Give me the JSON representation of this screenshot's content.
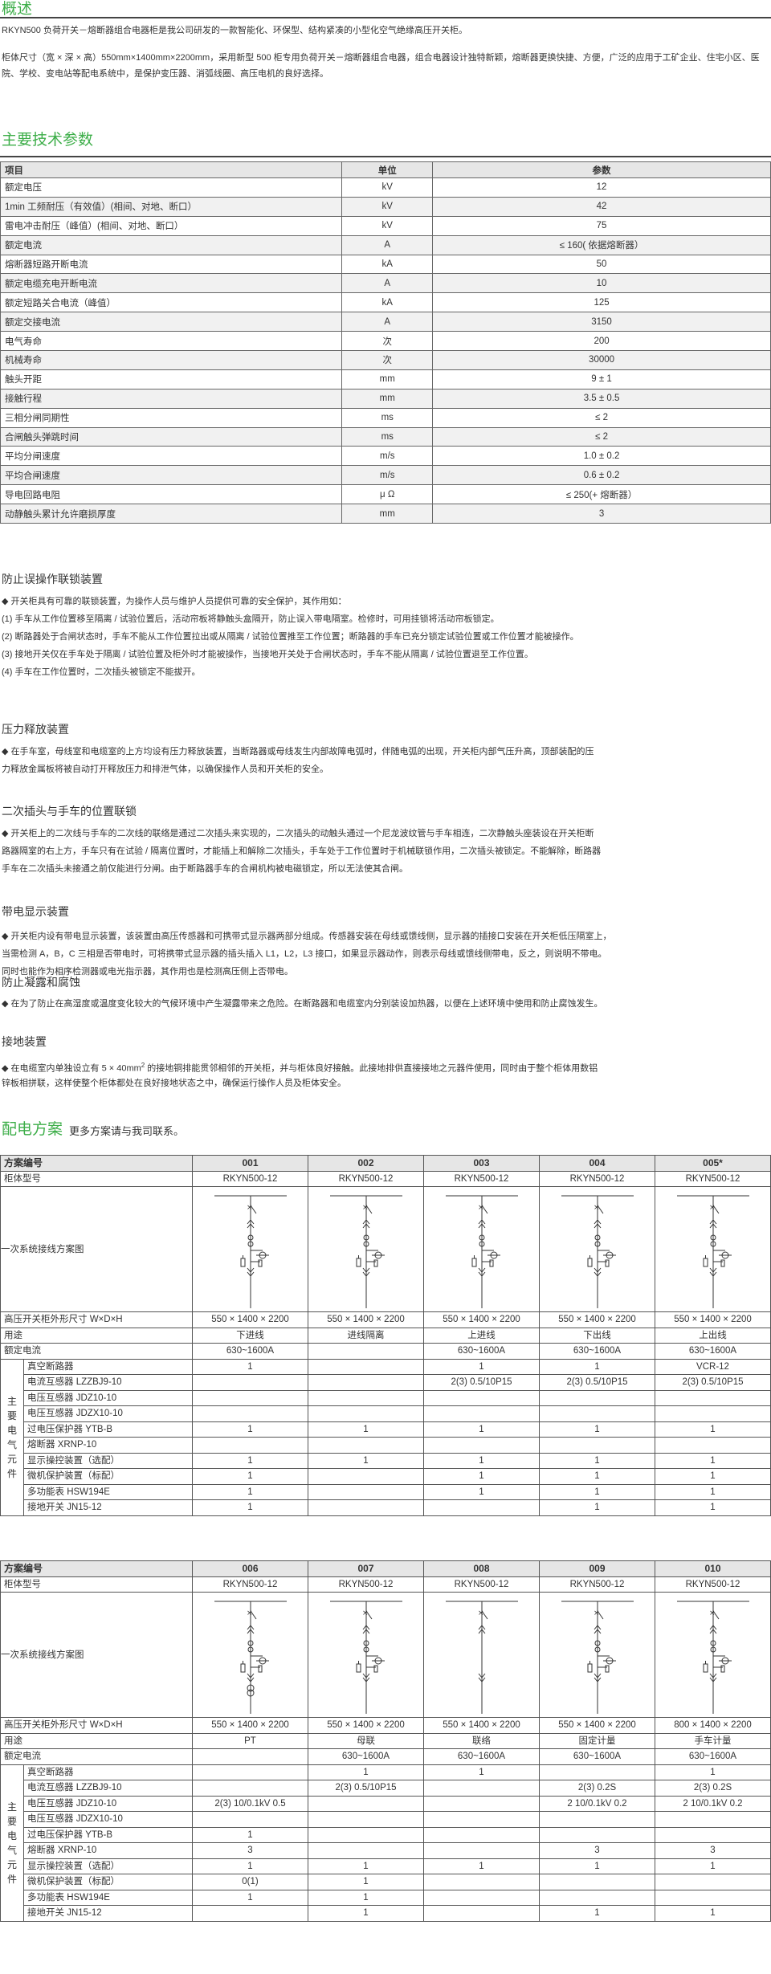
{
  "overview": {
    "title": "概述",
    "p1": "RKYN500 负荷开关－熔断器组合电器柜是我公司研发的一款智能化、环保型、结构紧凑的小型化空气绝缘高压开关柜。",
    "p2": "柜体尺寸（宽 × 深 × 高）550mm×1400mm×2200mm，采用新型 500 柜专用负荷开关－熔断器组合电器，组合电器设计独特新颖，熔断器更换快捷、方便，广泛的应用于工矿企业、住宅小区、医院、学校、变电站等配电系统中，是保护变压器、消弧线圈、高压电机的良好选择。"
  },
  "params": {
    "title": "主要技术参数",
    "headers": [
      "项目",
      "单位",
      "参数"
    ],
    "rows": [
      [
        "额定电压",
        "kV",
        "12"
      ],
      [
        "1min 工频耐压（有效值）(相间、对地、断口）",
        "kV",
        "42"
      ],
      [
        "雷电冲击耐压（峰值）(相间、对地、断口）",
        "kV",
        "75"
      ],
      [
        "额定电流",
        "A",
        "≤ 160( 依据熔断器）"
      ],
      [
        "熔断器短路开断电流",
        "kA",
        "50"
      ],
      [
        "额定电缆充电开断电流",
        "A",
        "10"
      ],
      [
        "额定短路关合电流（峰值）",
        "kA",
        "125"
      ],
      [
        "额定交接电流",
        "A",
        "3150"
      ],
      [
        "电气寿命",
        "次",
        "200"
      ],
      [
        "机械寿命",
        "次",
        "30000"
      ],
      [
        "触头开距",
        "mm",
        "9 ± 1"
      ],
      [
        "接触行程",
        "mm",
        "3.5 ± 0.5"
      ],
      [
        "三相分闸同期性",
        "ms",
        "≤ 2"
      ],
      [
        "合闸触头弹跳时间",
        "ms",
        "≤ 2"
      ],
      [
        "平均分闸速度",
        "m/s",
        "1.0 ± 0.2"
      ],
      [
        "平均合闸速度",
        "m/s",
        "0.6 ± 0.2"
      ],
      [
        "导电回路电阻",
        "μ Ω",
        "≤ 250(+ 熔断器）"
      ],
      [
        "动静触头累计允许磨损厚度",
        "mm",
        "3"
      ]
    ]
  },
  "sections": {
    "interlock": {
      "title": "防止误操作联锁装置",
      "lines": [
        "◆  开关柜具有可靠的联锁装置，为操作人员与维护人员提供可靠的安全保护，其作用如：",
        "(1) 手车从工作位置移至隔离 / 试验位置后，活动帘板将静触头盒隔开，防止误入带电隔室。检修时，可用挂锁将活动帘板锁定。",
        "(2) 断路器处于合闸状态时，手车不能从工作位置拉出或从隔离 / 试验位置推至工作位置；断路器的手车已充分锁定试验位置或工作位置才能被操作。",
        "(3) 接地开关仅在手车处于隔离 / 试验位置及柜外时才能被操作，当接地开关处于合闸状态时，手车不能从隔离 / 试验位置退至工作位置。",
        "(4) 手车在工作位置时，二次插头被锁定不能拔开。"
      ]
    },
    "pressure": {
      "title": "压力释放装置",
      "lines": [
        "◆  在手车室，母线室和电缆室的上方均设有压力释放装置，当断路器或母线发生内部故障电弧时，伴随电弧的出现，开关柜内部气压升高，顶部装配的压",
        "力释放金属板将被自动打开释放压力和排泄气体，以确保操作人员和开关柜的安全。"
      ]
    },
    "secondary": {
      "title": "二次插头与手车的位置联锁",
      "lines": [
        "◆  开关柜上的二次线与手车的二次线的联络是通过二次插头来实现的，二次插头的动触头通过一个尼龙波纹管与手车相连，二次静触头座装设在开关柜断",
        "路器隔室的右上方，手车只有在试验 / 隔离位置时，才能插上和解除二次插头，手车处于工作位置时于机械联锁作用，二次插头被锁定。不能解除，断路器",
        "手车在二次插头未接通之前仅能进行分闸。由于断路器手车的合闸机构被电磁锁定，所以无法使其合闸。"
      ]
    },
    "display": {
      "title": "带电显示装置",
      "lines": [
        "◆  开关柜内设有带电显示装置，该装置由高压传感器和可携带式显示器两部分组成。传感器安装在母线或馈线侧，显示器的插接口安装在开关柜低压隔室上，",
        "当需检测 A，B，C 三相是否带电时，可将携带式显示器的插头插入 L1，L2，L3 接口，如果显示器动作，则表示母线或馈线侧带电，反之，则说明不带电。",
        "同时也能作为相序检测器或电光指示器，其作用也是检测高压侧上否带电。"
      ]
    },
    "condense": {
      "title": "防止凝露和腐蚀",
      "lines": [
        "◆  在为了防止在高湿度或温度变化较大的气候环境中产生凝露带来之危险。在断路器和电缆室内分别装设加热器，以便在上述环境中使用和防止腐蚀发生。"
      ]
    },
    "ground": {
      "title": "接地装置",
      "line1_a": "◆  在电缆室内单独设立有 5 × 40mm",
      "line1_sup": "2",
      "line1_b": " 的接地铜排能贯邻相邻的开关柜，并与柜体良好接触。此接地排供直接接地之元器件使用，同时由于整个柜体用数铝",
      "line2": "锌板相拼联，这样使整个柜体都处在良好接地状态之中，确保运行操作人员及柜体安全。"
    }
  },
  "scheme": {
    "title": "配电方案",
    "subtitle": "更多方案请与我司联系。",
    "row_labels": {
      "scheme_no": "方案编号",
      "model": "柜体型号",
      "diagram": "一次系统接线方案图",
      "size": "高压开关柜外形尺寸 W×D×H",
      "use": "用途",
      "current": "额定电流",
      "group": "主要电气元件"
    },
    "components": [
      "真空断路器",
      "电流互感器 LZZBJ9-10",
      "电压互感器 JDZ10-10",
      "电压互感器 JDZX10-10",
      "过电压保护器 YTB-B",
      "熔断器 XRNP-10",
      "显示操控装置（选配）",
      "微机保护装置（标配）",
      "多功能表 HSW194E",
      "接地开关 JN15-12"
    ],
    "table1": [
      {
        "no": "001",
        "model": "RKYN500-12",
        "size": "550 × 1400 × 2200",
        "use": "下进线",
        "current": "630~1600A",
        "comp": [
          "1",
          "",
          "",
          "",
          "1",
          "",
          "1",
          "1",
          "1",
          "1"
        ]
      },
      {
        "no": "002",
        "model": "RKYN500-12",
        "size": "550 × 1400 × 2200",
        "use": "进线隔离",
        "current": "",
        "comp": [
          "",
          "",
          "",
          "",
          "1",
          "",
          "1",
          "",
          "",
          ""
        ]
      },
      {
        "no": "003",
        "model": "RKYN500-12",
        "size": "550 × 1400 × 2200",
        "use": "上进线",
        "current": "630~1600A",
        "comp": [
          "1",
          "2(3)  0.5/10P15",
          "",
          "",
          "1",
          "",
          "1",
          "1",
          "1",
          ""
        ]
      },
      {
        "no": "004",
        "model": "RKYN500-12",
        "size": "550 × 1400 × 2200",
        "use": "下出线",
        "current": "630~1600A",
        "comp": [
          "1",
          "2(3)  0.5/10P15",
          "",
          "",
          "1",
          "",
          "1",
          "1",
          "1",
          "1"
        ]
      },
      {
        "no": "005*",
        "model": "RKYN500-12",
        "size": "550 × 1400 × 2200",
        "use": "上出线",
        "current": "630~1600A",
        "comp": [
          "VCR-12",
          "2(3)  0.5/10P15",
          "",
          "",
          "1",
          "",
          "1",
          "1",
          "1",
          "1"
        ]
      }
    ],
    "table1_first_ct": "2(3)  0.5/10P15",
    "table2": [
      {
        "no": "006",
        "model": "RKYN500-12",
        "size": "550 × 1400 × 2200",
        "use": "PT",
        "current": "",
        "comp": [
          "",
          "",
          "2(3)  10/0.1kV 0.5",
          "",
          "1",
          "3",
          "1",
          "0(1)",
          "1",
          ""
        ]
      },
      {
        "no": "007",
        "model": "RKYN500-12",
        "size": "550 × 1400 × 2200",
        "use": "母联",
        "current": "630~1600A",
        "comp": [
          "1",
          "2(3)  0.5/10P15",
          "",
          "",
          "",
          "",
          "1",
          "1",
          "1",
          "1"
        ]
      },
      {
        "no": "008",
        "model": "RKYN500-12",
        "size": "550 × 1400 × 2200",
        "use": "联络",
        "current": "630~1600A",
        "comp": [
          "1",
          "",
          "",
          "",
          "",
          "",
          "1",
          "",
          "",
          ""
        ]
      },
      {
        "no": "009",
        "model": "RKYN500-12",
        "size": "550 × 1400 × 2200",
        "use": "固定计量",
        "current": "630~1600A",
        "comp": [
          "",
          "2(3)  0.2S",
          "2  10/0.1kV 0.2",
          "",
          "",
          "3",
          "1",
          "",
          "",
          "1"
        ]
      },
      {
        "no": "010",
        "model": "RKYN500-12",
        "size": "800 × 1400 × 2200",
        "use": "手车计量",
        "current": "630~1600A",
        "comp": [
          "1",
          "2(3)  0.2S",
          "2  10/0.1kV 0.2",
          "",
          "",
          "3",
          "1",
          "",
          "",
          "1"
        ]
      }
    ],
    "abc_labels": [
      "A",
      "B",
      "C"
    ]
  }
}
